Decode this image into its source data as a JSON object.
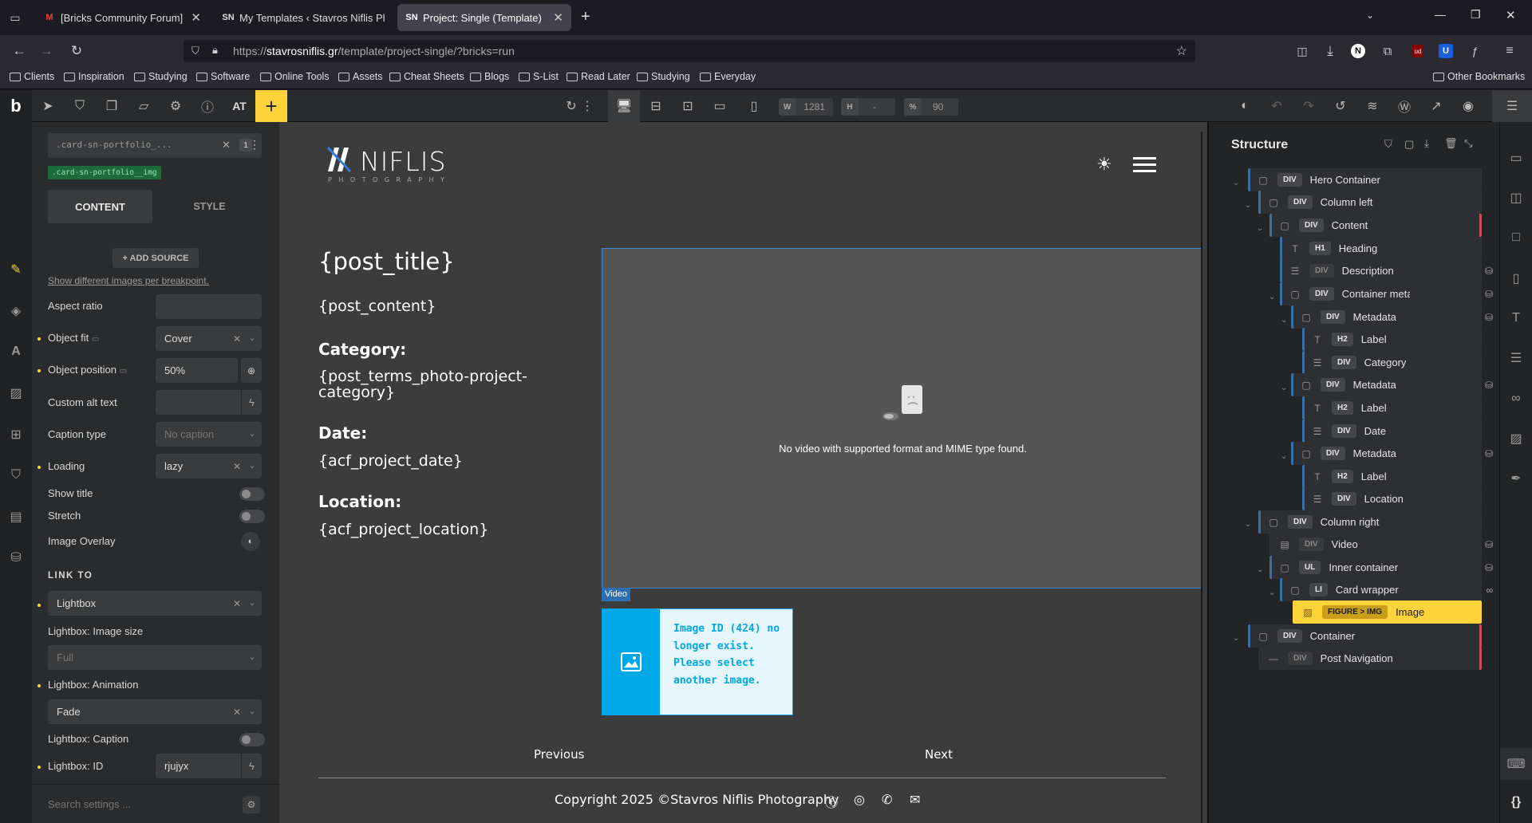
{
  "tabs": [
    {
      "title": "[Bricks Community Forum] [Bug]",
      "favicon": "M"
    },
    {
      "title": "My Templates ‹ Stavros Niflis Ph",
      "favicon": "SN"
    },
    {
      "title": "Project: Single (Template)",
      "favicon": "SN",
      "active": true
    }
  ],
  "url": {
    "prefix": "https://",
    "domain": "stavrosniflis.gr",
    "path": "/template/project-single/?bricks=run"
  },
  "bookmarks": [
    "Clients",
    "Inspiration",
    "Studying",
    "Software",
    "Online Tools",
    "Assets",
    "Cheat Sheets",
    "Blogs",
    "S-List",
    "Read Later",
    "Studying",
    "Everyday"
  ],
  "other_bookmarks": "Other Bookmarks",
  "toolbar": {
    "logo": "b",
    "at": "AT",
    "add": "+",
    "width_label": "W",
    "width": "1281",
    "height_label": "H",
    "height": "-",
    "zoom_label": "%",
    "zoom": "90"
  },
  "left": {
    "selector": ".card-sn-portfolio_...",
    "selector_count": "1",
    "class_chip": ".card-sn-portfolio__img",
    "tab_content": "CONTENT",
    "tab_style": "STYLE",
    "add_source": "+ ADD SOURCE",
    "breakpoint_link": "Show different images per breakpoint.",
    "aspect_ratio": "Aspect ratio",
    "object_fit": "Object fit",
    "object_fit_value": "Cover",
    "object_position": "Object position",
    "object_position_value": "50%",
    "custom_alt": "Custom alt text",
    "caption_type": "Caption type",
    "caption_type_value": "No caption",
    "loading": "Loading",
    "loading_value": "lazy",
    "show_title": "Show title",
    "stretch": "Stretch",
    "image_overlay": "Image Overlay",
    "link_to": "LINK TO",
    "link_to_value": "Lightbox",
    "lb_size": "Lightbox: Image size",
    "lb_size_value": "Full",
    "lb_anim": "Lightbox: Animation",
    "lb_anim_value": "Fade",
    "lb_caption": "Lightbox: Caption",
    "lb_id": "Lightbox: ID",
    "lb_id_value": "rjujyx",
    "search_placeholder": "Search settings ..."
  },
  "canvas": {
    "logo": "NIFLIS",
    "logo_sub": "PHOTOGRAPHY",
    "post_title": "{post_title}",
    "post_content": "{post_content}",
    "category_label": "Category:",
    "category_value": "{post_terms_photo-project-category}",
    "date_label": "Date:",
    "date_value": "{acf_project_date}",
    "location_label": "Location:",
    "location_value": "{acf_project_location}",
    "video_msg": "No video with supported format and MIME type found.",
    "video_tag": "Video",
    "image_msg": "Image ID (424) no longer exist. Please select another image.",
    "prev": "Previous",
    "next": "Next",
    "copyright": "Copyright 2025 ©Stavros Niflis Photography"
  },
  "structure": {
    "title": "Structure",
    "nodes": [
      {
        "tag": "DIV",
        "label": "Hero Container"
      },
      {
        "tag": "DIV",
        "label": "Column left"
      },
      {
        "tag": "DIV",
        "label": "Content"
      },
      {
        "tag": "H1",
        "label": "Heading"
      },
      {
        "tag": "DIV",
        "label": "Description"
      },
      {
        "tag": "DIV",
        "label": "Container meta"
      },
      {
        "tag": "DIV",
        "label": "Metadata"
      },
      {
        "tag": "H2",
        "label": "Label"
      },
      {
        "tag": "DIV",
        "label": "Category"
      },
      {
        "tag": "DIV",
        "label": "Metadata"
      },
      {
        "tag": "H2",
        "label": "Label"
      },
      {
        "tag": "DIV",
        "label": "Date"
      },
      {
        "tag": "DIV",
        "label": "Metadata"
      },
      {
        "tag": "H2",
        "label": "Label"
      },
      {
        "tag": "DIV",
        "label": "Location"
      },
      {
        "tag": "DIV",
        "label": "Column right"
      },
      {
        "tag": "DIV",
        "label": "Video"
      },
      {
        "tag": "UL",
        "label": "Inner container"
      },
      {
        "tag": "LI",
        "label": "Card wrapper"
      },
      {
        "tag": "FIGURE > IMG",
        "label": "Image"
      },
      {
        "tag": "DIV",
        "label": "Container"
      },
      {
        "tag": "DIV",
        "label": "Post Navigation"
      }
    ]
  },
  "colors": {
    "accent": "#ffd43b",
    "selection": "#3b6fa8",
    "image_placeholder": "#00a8e8",
    "canvas_bg": "#3c3c3c"
  }
}
